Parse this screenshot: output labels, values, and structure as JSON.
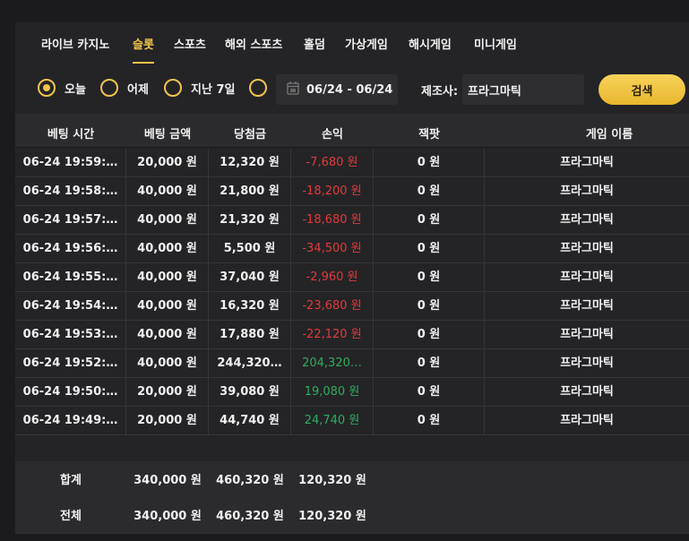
{
  "tabs": [
    {
      "label": "라이브 카지노",
      "active": false
    },
    {
      "label": "슬롯",
      "active": true
    },
    {
      "label": "스포츠",
      "active": false
    },
    {
      "label": "해외 스포츠",
      "active": false
    },
    {
      "label": "홀덤",
      "active": false
    },
    {
      "label": "가상게임",
      "active": false
    },
    {
      "label": "해시게임",
      "active": false
    },
    {
      "label": "미니게임",
      "active": false
    }
  ],
  "filter": {
    "today": "오늘",
    "yesterday": "어제",
    "last7": "지난 7일",
    "selected": "today",
    "date_range": "06/24 - 06/24",
    "maker_label": "제조사:",
    "maker_value": "프라그마틱",
    "search_label": "검색"
  },
  "columns": [
    "베팅 시간",
    "베팅 금액",
    "당첨금",
    "손익",
    "잭팟",
    "게임 이름"
  ],
  "rows": [
    {
      "time": "06-24 19:59:…",
      "bet": "20,000 원",
      "win": "12,320 원",
      "pl": "-7,680 원",
      "pl_sign": "neg",
      "jackpot": "0 원",
      "game": "프라그마틱"
    },
    {
      "time": "06-24 19:58:…",
      "bet": "40,000 원",
      "win": "21,800 원",
      "pl": "-18,200 원",
      "pl_sign": "neg",
      "jackpot": "0 원",
      "game": "프라그마틱"
    },
    {
      "time": "06-24 19:57:…",
      "bet": "40,000 원",
      "win": "21,320 원",
      "pl": "-18,680 원",
      "pl_sign": "neg",
      "jackpot": "0 원",
      "game": "프라그마틱"
    },
    {
      "time": "06-24 19:56:…",
      "bet": "40,000 원",
      "win": "5,500 원",
      "pl": "-34,500 원",
      "pl_sign": "neg",
      "jackpot": "0 원",
      "game": "프라그마틱"
    },
    {
      "time": "06-24 19:55:…",
      "bet": "40,000 원",
      "win": "37,040 원",
      "pl": "-2,960 원",
      "pl_sign": "neg",
      "jackpot": "0 원",
      "game": "프라그마틱"
    },
    {
      "time": "06-24 19:54:…",
      "bet": "40,000 원",
      "win": "16,320 원",
      "pl": "-23,680 원",
      "pl_sign": "neg",
      "jackpot": "0 원",
      "game": "프라그마틱"
    },
    {
      "time": "06-24 19:53:…",
      "bet": "40,000 원",
      "win": "17,880 원",
      "pl": "-22,120 원",
      "pl_sign": "neg",
      "jackpot": "0 원",
      "game": "프라그마틱"
    },
    {
      "time": "06-24 19:52:…",
      "bet": "40,000 원",
      "win": "244,320…",
      "pl": "204,320…",
      "pl_sign": "pos",
      "jackpot": "0 원",
      "game": "프라그마틱"
    },
    {
      "time": "06-24 19:50:…",
      "bet": "20,000 원",
      "win": "39,080 원",
      "pl": "19,080 원",
      "pl_sign": "pos",
      "jackpot": "0 원",
      "game": "프라그마틱"
    },
    {
      "time": "06-24 19:49:…",
      "bet": "20,000 원",
      "win": "44,740 원",
      "pl": "24,740 원",
      "pl_sign": "pos",
      "jackpot": "0 원",
      "game": "프라그마틱"
    }
  ],
  "summary": [
    {
      "label": "합계",
      "bet": "340,000 원",
      "win": "460,320 원",
      "pl": "120,320 원"
    },
    {
      "label": "전체",
      "bet": "340,000 원",
      "win": "460,320 원",
      "pl": "120,320 원"
    }
  ],
  "colors": {
    "accent": "#f3c44a",
    "negative": "#e03b3b",
    "positive": "#2eae5e"
  },
  "icons": {
    "date": "calendar-icon"
  }
}
